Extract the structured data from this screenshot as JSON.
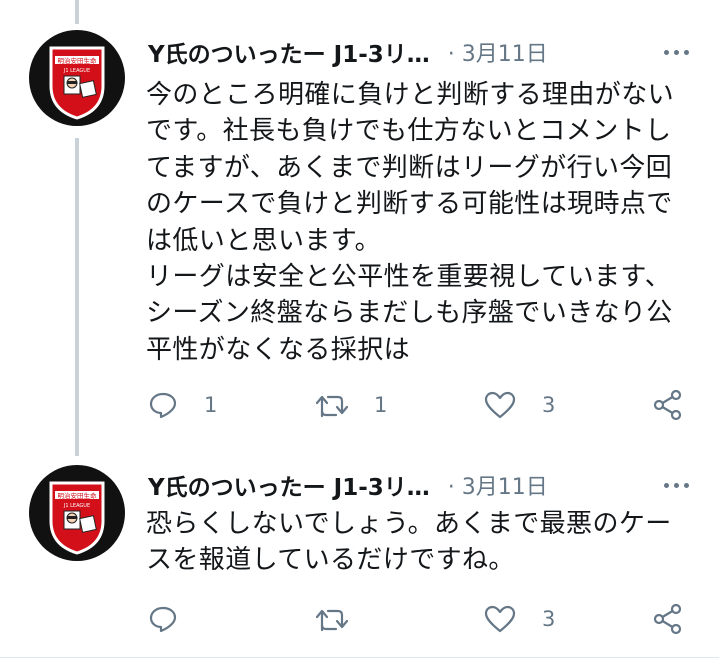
{
  "tweets": [
    {
      "author_name": "Y氏のついったー J1-3リ…",
      "meta": "· 3月11日",
      "text": "今のところ明確に負けと判断する理由がないです。社長も負けでも仕方ないとコメントしてますが、あくまで判断はリーグが行い今回のケースで負けと判断する可能性は現時点では低いと思います。\nリーグは安全と公平性を重要視しています、シーズン終盤ならまだしも序盤でいきなり公平性がなくなる採択は",
      "reply_count": "1",
      "retweet_count": "1",
      "like_count": "3",
      "avatar_text_top": "明治安田生命",
      "avatar_text_bottom": "J1 LEAGUE"
    },
    {
      "author_name": "Y氏のついったー J1-3リ…",
      "meta": "· 3月11日",
      "text": "恐らくしないでしょう。あくまで最悪のケースを報道しているだけですね。",
      "reply_count": "",
      "retweet_count": "",
      "like_count": "3",
      "avatar_text_top": "明治安田生命",
      "avatar_text_bottom": "J1 LEAGUE"
    }
  ],
  "icons": {
    "reply": "reply-icon",
    "retweet": "retweet-icon",
    "like": "heart-icon",
    "share": "share-icon",
    "more": "more-icon"
  },
  "colors": {
    "text": "#14171a",
    "secondary": "#657786",
    "thread_line": "#c9d2d9",
    "avatar_red": "#d3101a"
  }
}
